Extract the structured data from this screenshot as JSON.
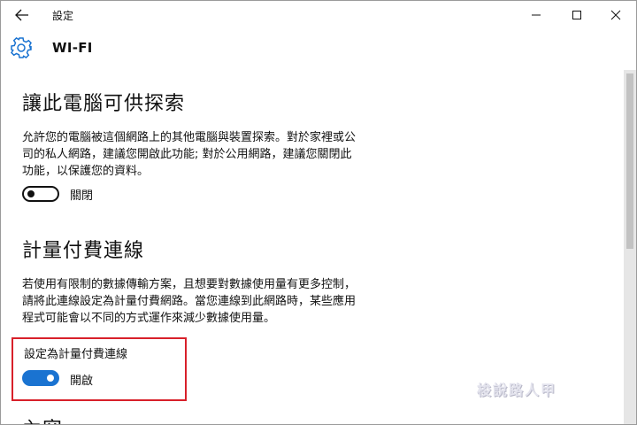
{
  "window": {
    "title": "設定",
    "header_title": "WI-FI"
  },
  "discoverable": {
    "heading": "讓此電腦可供探索",
    "description": [
      "允許您的電腦被這個網路上的其他電腦與裝置探索。對於家裡或公",
      "司的私人網路，建議您開啟此功能; 對於公用網路，建議您關閉此",
      "功能，以保護您的資料。"
    ],
    "toggle_state": "關閉",
    "toggle_on": false
  },
  "metered": {
    "heading": "計量付費連線",
    "description": [
      "若使用有限制的數據傳輸方案，且想要對數據使用量有更多控制，",
      "請將此連線設定為計量付費網路。當您連線到此網路時，某些應用",
      "程式可能會以不同的方式運作來減少數據使用量。"
    ],
    "setting_label": "設定為計量付費連線",
    "toggle_state": "開啟",
    "toggle_on": true
  },
  "next_section_partial": "內容",
  "watermark": "梭說路人甲",
  "colors": {
    "accent": "#1a73d1",
    "highlight": "#d8202a",
    "gear": "#1a73d1"
  },
  "icons": [
    "back-arrow-icon",
    "minimize-icon",
    "maximize-icon",
    "close-icon",
    "gear-icon"
  ]
}
